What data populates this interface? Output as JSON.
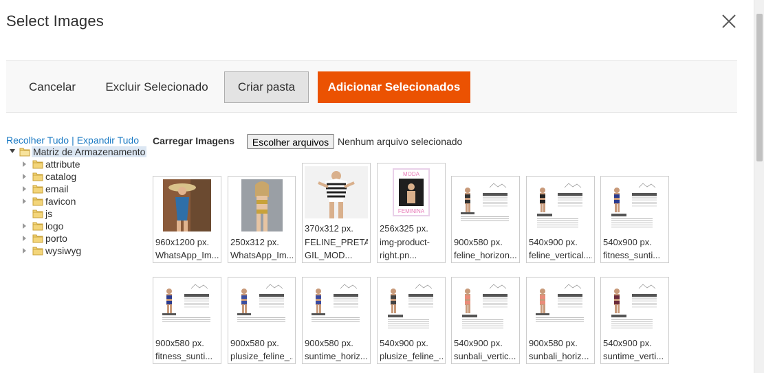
{
  "modal": {
    "title": "Select Images",
    "close_icon": "close-icon"
  },
  "actions": {
    "cancel": "Cancelar",
    "delete_selected": "Excluir Selecionado",
    "create_folder": "Criar pasta",
    "add_selected": "Adicionar Selecionados",
    "accent_color": "#eb5202"
  },
  "tree_controls": {
    "collapse_all": "Recolher Tudo",
    "separator": "|",
    "expand_all": "Expandir Tudo"
  },
  "upload": {
    "label": "Carregar Imagens",
    "choose_files": "Escolher arquivos",
    "status": "Nenhum arquivo selecionado"
  },
  "tree": {
    "root": "Matriz de Armazenamento",
    "folders": [
      "attribute",
      "catalog",
      "email",
      "favicon",
      "js",
      "logo",
      "porto",
      "wysiwyg"
    ]
  },
  "images": [
    {
      "dim": "960x1200 px.",
      "name": "WhatsApp_Im..."
    },
    {
      "dim": "250x312 px.",
      "name": "WhatsApp_Im..."
    },
    {
      "dim": "370x312 px.",
      "name": "FELINE_PRETA-",
      "name2": "GIL_MOD..."
    },
    {
      "dim": "256x325 px.",
      "name": "img-product-",
      "name2": "right.pn..."
    },
    {
      "dim": "900x580 px.",
      "name": "feline_horizon..."
    },
    {
      "dim": "540x900 px.",
      "name": "feline_vertical...."
    },
    {
      "dim": "540x900 px.",
      "name": "fitness_sunti..."
    },
    {
      "dim": "900x580 px.",
      "name": "fitness_sunti..."
    },
    {
      "dim": "900x580 px.",
      "name": "plusize_feline_..."
    },
    {
      "dim": "900x580 px.",
      "name": "suntime_horiz..."
    },
    {
      "dim": "540x900 px.",
      "name": "plusize_feline_..."
    },
    {
      "dim": "540x900 px.",
      "name": "sunbali_vertic..."
    },
    {
      "dim": "900x580 px.",
      "name": "sunbali_horiz..."
    },
    {
      "dim": "540x900 px.",
      "name": "suntime_verti..."
    }
  ]
}
